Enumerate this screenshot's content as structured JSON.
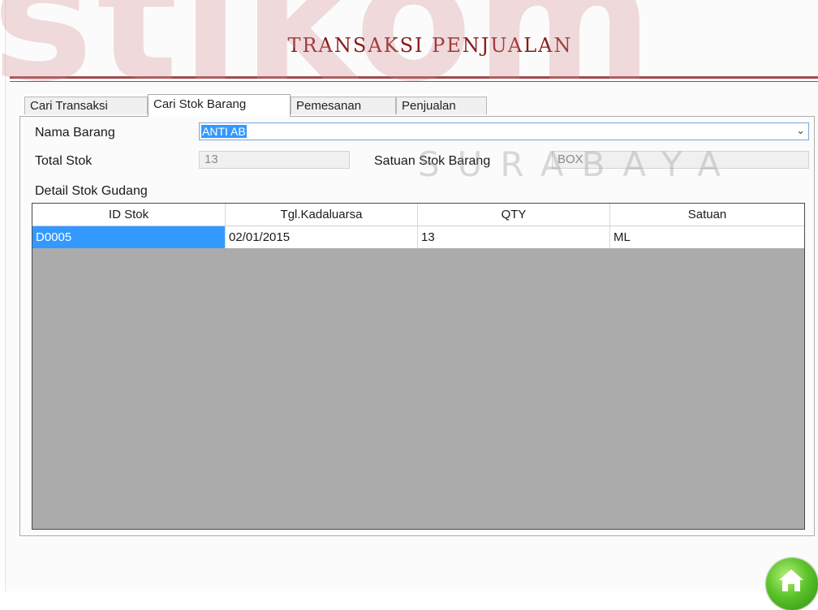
{
  "watermark": {
    "logo": "stikom",
    "city": "SURABAYA"
  },
  "page_title": "TRANSAKSI PENJUALAN",
  "tabs": [
    {
      "label": "Cari Transaksi",
      "active": false
    },
    {
      "label": "Cari Stok Barang",
      "active": true
    },
    {
      "label": "Pemesanan",
      "active": false
    },
    {
      "label": "Penjualan",
      "active": false
    }
  ],
  "form": {
    "nama_barang_label": "Nama Barang",
    "nama_barang_value": "ANTI AB",
    "total_stok_label": "Total Stok",
    "total_stok_value": "13",
    "satuan_label": "Satuan Stok Barang",
    "satuan_value": "BOX",
    "detail_label": "Detail Stok Gudang"
  },
  "table": {
    "columns": [
      "ID Stok",
      "Tgl.Kadaluarsa",
      "QTY",
      "Satuan"
    ],
    "rows": [
      [
        "D0005",
        "02/01/2015",
        "13",
        "ML"
      ]
    ]
  },
  "colors": {
    "title": "#8b1a1a",
    "rule": "#a14b4b",
    "selection": "#3399ff",
    "grid_empty": "#ababab",
    "home_button": "#5cc32b"
  },
  "icons": {
    "home": "home-icon",
    "dropdown": "chevron-down-icon"
  }
}
